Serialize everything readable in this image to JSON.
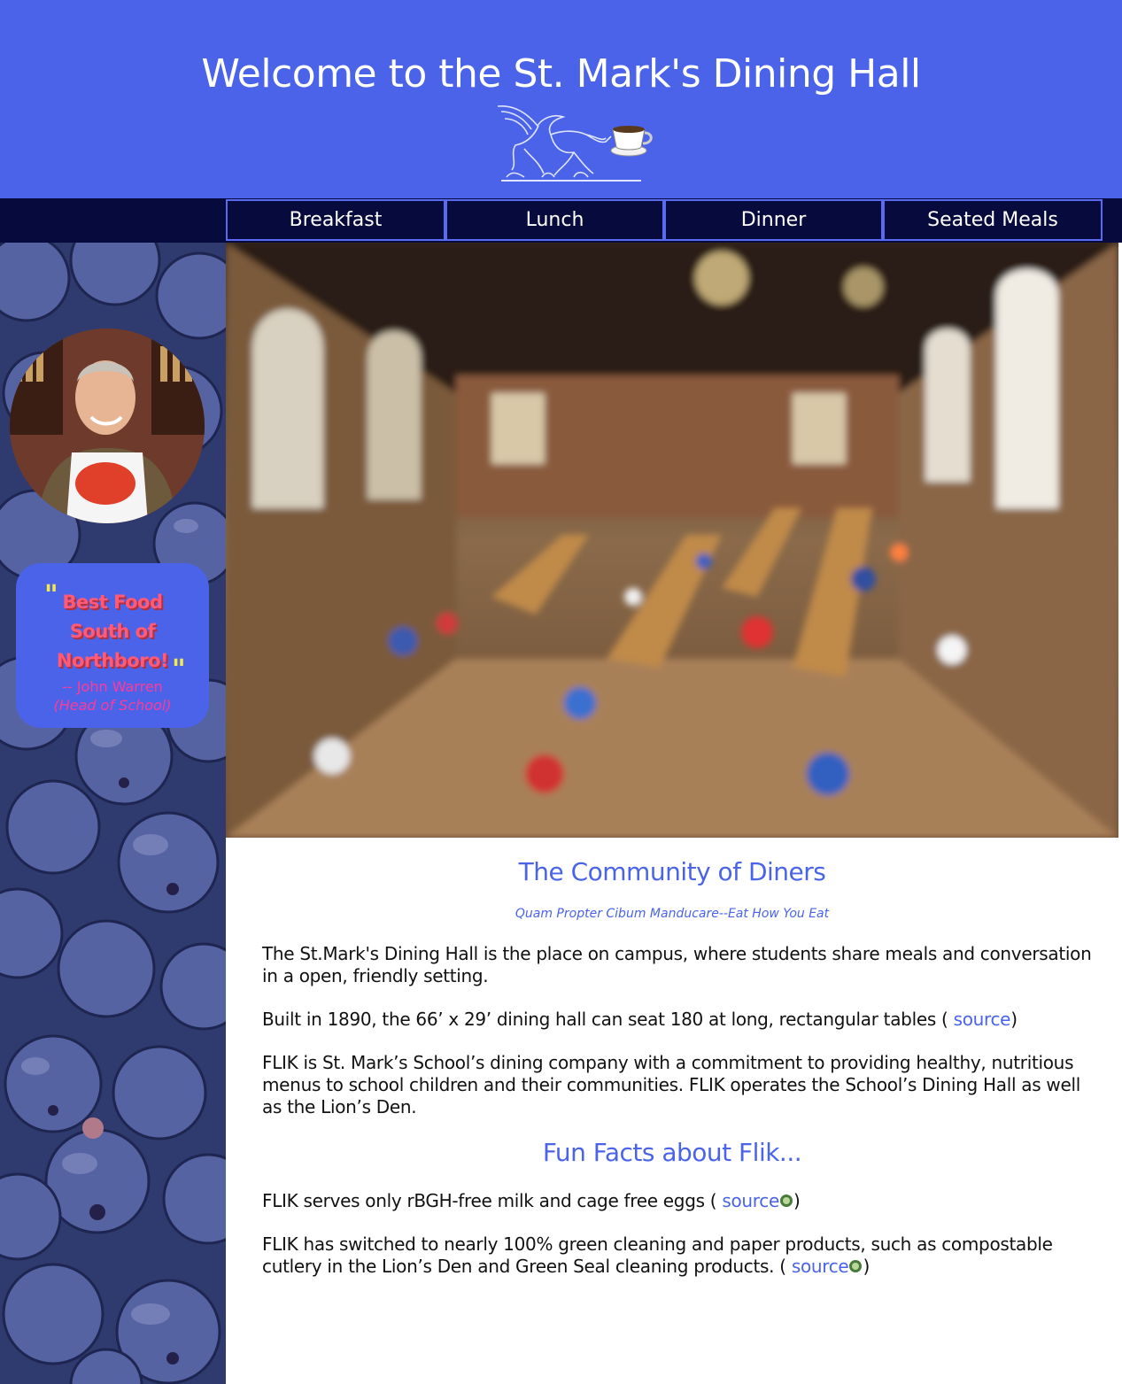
{
  "header": {
    "title": "Welcome to the St. Mark's Dining Hall",
    "crest_icon": "griffin-with-coffee-cup"
  },
  "nav": {
    "items": [
      "Breakfast",
      "Lunch",
      "Dinner",
      "Seated Meals"
    ]
  },
  "sidebar": {
    "quote": {
      "line1": "Best Food",
      "line2": "South of",
      "line3": "Northboro!",
      "author": "-- John Warren",
      "role": "(Head of School)"
    }
  },
  "content": {
    "section1_title": "The Community of Diners",
    "motto": "Quam Propter Cibum Manducare--Eat How You Eat",
    "p1": "The St.Mark's Dining Hall is the place on campus, where students share meals and conversation in a open, friendly setting.",
    "p2_text": "Built in 1890, the 66’ x 29’ dining hall can seat 180 at long, rectangular tables (",
    "p2_link": " source",
    "p2_end": ")",
    "p3": "FLIK is St. Mark’s School’s dining company with a commitment to providing healthy, nutritious menus to school children and their communities. FLIK operates the School’s Dining Hall as well as the Lion’s Den.",
    "section2_title": "Fun Facts about Flik...",
    "p4_text": "FLIK serves only rBGH-free milk and cage free eggs (",
    "p4_link": " source",
    "p4_end": ")",
    "p5_text": "FLIK has switched to nearly 100% green cleaning and paper products, such as compostable cutlery in the Lion’s Den and Green Seal cleaning products. (",
    "p5_link": " source",
    "p5_end": ")"
  },
  "colors": {
    "header_bg": "#4a63e8",
    "nav_bg": "#070a3c",
    "accent": "#4a63e8",
    "quote_text": "#ff5a78",
    "quote_author": "#ff3b9a"
  }
}
